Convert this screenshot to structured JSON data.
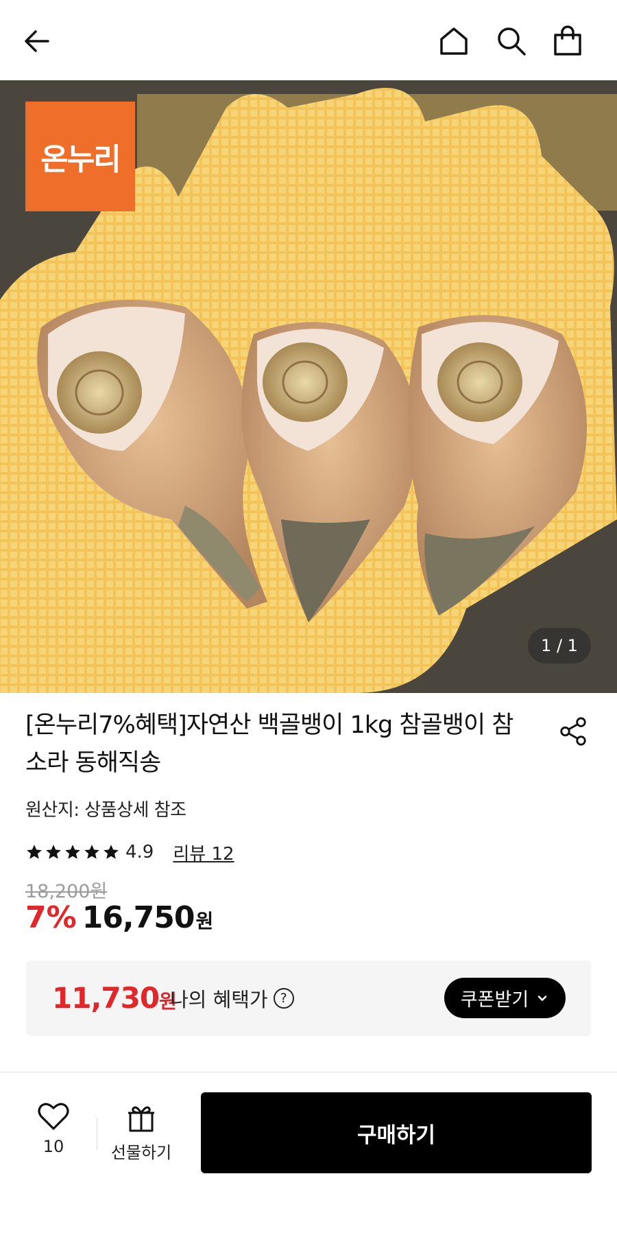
{
  "header": {
    "back_icon": "arrow-left-icon",
    "home_icon": "home-icon",
    "search_icon": "search-icon",
    "cart_icon": "shopping-bag-icon"
  },
  "hero": {
    "logo_text": "온누리",
    "logo_color": "#ef6e2a",
    "pager": "1 / 1"
  },
  "product": {
    "title": "[온누리7%혜택]자연산 백골뱅이 1kg 참골뱅이 참소라 동해직송",
    "origin": "원산지: 상품상세 참조",
    "rating": {
      "stars": 5,
      "score": "4.9",
      "review_link": "리뷰 12"
    },
    "original_price": "18,200원",
    "discount": "7%",
    "price": "16,750",
    "currency": "원",
    "accent_color": "#e0282a"
  },
  "benefit": {
    "price": "11,730",
    "currency": "원",
    "label": "나의 혜택가",
    "help": "?",
    "coupon_button": "쿠폰받기"
  },
  "bottom_bar": {
    "like_count": "10",
    "gift_label": "선물하기",
    "buy_button": "구매하기"
  }
}
